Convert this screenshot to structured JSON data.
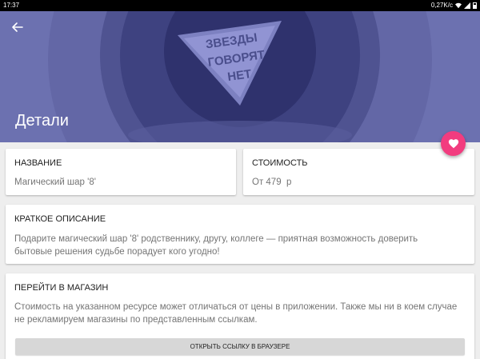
{
  "statusbar": {
    "time": "17:37",
    "speed": "0,27K/c"
  },
  "header": {
    "title": "Детали",
    "ball_text": [
      "ЗВЕЗДЫ",
      "ГОВОРЯТ",
      "НЕТ"
    ]
  },
  "cards": {
    "name": {
      "heading": "НАЗВАНИЕ",
      "value": "Магический шар '8'"
    },
    "cost": {
      "heading": "СТОИМОСТЬ",
      "value": "От 479  р"
    },
    "description": {
      "heading": "КРАТКОЕ ОПИСАНИЕ",
      "value": "Подарите магический шар '8' родственнику, другу, коллеге — приятная возможность доверить бытовые решения судьбе порадует кого угодно!"
    },
    "shop": {
      "heading": "ПЕРЕЙТИ В МАГАЗИН",
      "value": "Стоимость на указанном ресурсе может отличаться от цены в приложении. Также мы ни в коем случае не рекламируем магазины по представленным ссылкам.",
      "button_label": "ОТКРЫТЬ ССЫЛКУ В БРАУЗЕРЕ"
    }
  },
  "icons": {
    "back": "arrow-back-icon",
    "favorite": "heart-icon"
  },
  "colors": {
    "header": "#6a6fae",
    "fab": "#f23c7f"
  }
}
